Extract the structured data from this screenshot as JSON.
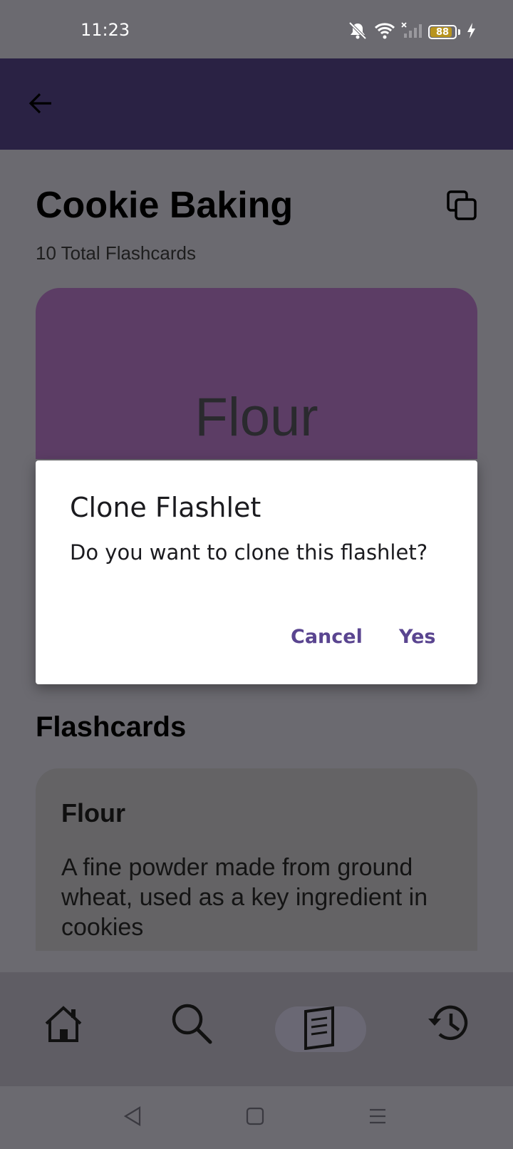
{
  "status_bar": {
    "time": "11:23",
    "battery_level": "88",
    "battery_fill_fraction": 0.88,
    "icons": [
      "mute-icon",
      "wifi-icon",
      "no-signal-icon",
      "battery-icon",
      "charging-icon"
    ]
  },
  "app_bar": {
    "back_icon": "arrow-back-icon"
  },
  "header": {
    "title": "Cookie Baking",
    "total_count": "10 Total Flashcards",
    "clone_icon": "copy-icon"
  },
  "card_preview": {
    "text": "Flour",
    "color": "#5c3d65"
  },
  "section": {
    "title": "Flashcards"
  },
  "flashcards": [
    {
      "term": "Flour",
      "definition": "A fine powder made from ground wheat, used as a key ingredient in cookies"
    }
  ],
  "bottom_nav": {
    "items": [
      {
        "icon": "home-icon"
      },
      {
        "icon": "search-icon"
      },
      {
        "icon": "flashcards-icon",
        "active": true
      },
      {
        "icon": "history-icon"
      }
    ]
  },
  "system_nav": {
    "icons": [
      "back-triangle-icon",
      "home-square-icon",
      "menu-lines-icon"
    ]
  },
  "dialog": {
    "title": "Clone Flashlet",
    "message": "Do you want to clone this flashlet?",
    "cancel_label": "Cancel",
    "confirm_label": "Yes",
    "accent_color": "#5a4590"
  }
}
